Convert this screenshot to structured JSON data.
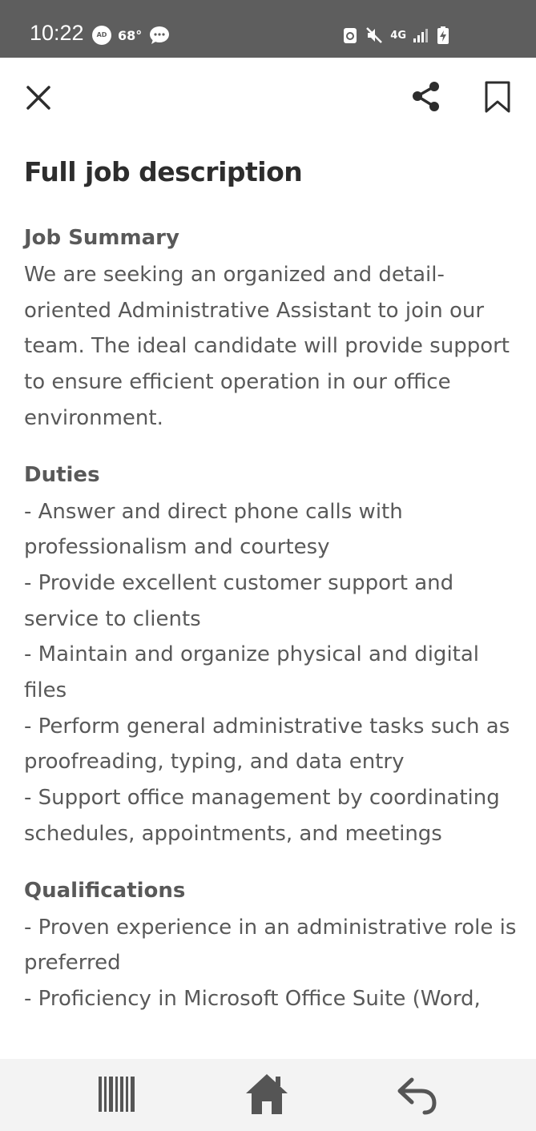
{
  "status_bar": {
    "time": "10:22",
    "ad_badge": "AD",
    "temperature": "68°",
    "network": "4G"
  },
  "icons": {
    "close": "close-icon",
    "share": "share-icon",
    "bookmark": "bookmark-icon",
    "recent_apps": "recent-apps-icon",
    "home": "home-icon",
    "back": "back-icon"
  },
  "page": {
    "title": "Full job description"
  },
  "sections": [
    {
      "heading": "Job Summary",
      "body": "We are seeking an organized and detail-oriented Administrative Assistant to join our team. The ideal candidate will provide support to ensure efficient operation in our office environment."
    },
    {
      "heading": "Duties",
      "items": [
        "- Answer and direct phone calls with professionalism and courtesy",
        "- Provide excellent customer support and service to clients",
        "- Maintain and organize physical and digital files",
        "- Perform general administrative tasks such as proofreading, typing, and data entry",
        "- Support office management by coordinating schedules, appointments, and meetings"
      ]
    },
    {
      "heading": "Qualifications",
      "items": [
        "- Proven experience in an administrative role is preferred",
        "- Proficiency in Microsoft Office Suite (Word,"
      ]
    }
  ],
  "colors": {
    "status_bar_bg": "#5e5e5e",
    "title_text": "#2d2d2d",
    "body_text": "#595959",
    "nav_bar_bg": "#f3f3f3"
  }
}
